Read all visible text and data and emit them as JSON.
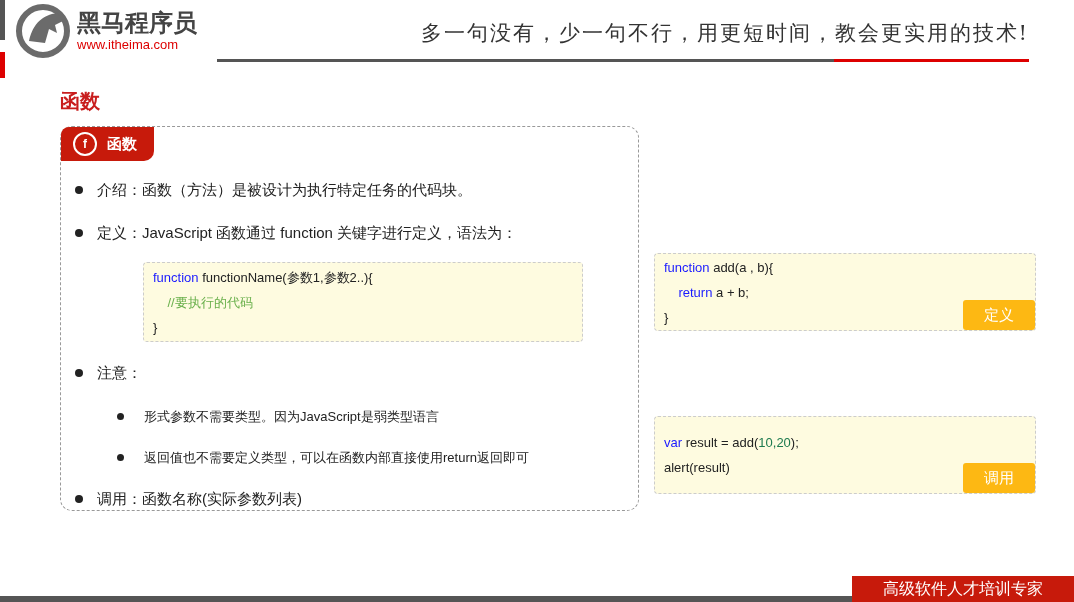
{
  "header": {
    "brand": "黑马程序员",
    "url": "www.itheima.com",
    "slogan": "多一句没有，少一句不行，用更短时间，教会更实用的技术!"
  },
  "section_title": "函数",
  "card": {
    "tab": {
      "icon_letter": "f",
      "label": "函数"
    },
    "items": [
      {
        "text": "介绍：函数（方法）是被设计为执行特定任务的代码块。"
      },
      {
        "text": "定义：JavaScript 函数通过 function 关键字进行定义，语法为：",
        "code": [
          {
            "tokens": [
              {
                "kind": "keyword",
                "text": "function"
              },
              {
                "kind": "plain",
                "text": " functionName(参数1,参数2..){"
              }
            ]
          },
          {
            "tokens": [
              {
                "kind": "comment",
                "text": "    //要执行的代码"
              }
            ]
          },
          {
            "tokens": [
              {
                "kind": "plain",
                "text": "}"
              }
            ]
          }
        ]
      },
      {
        "text": "注意：",
        "children": [
          {
            "text": "形式参数不需要类型。因为JavaScript是弱类型语言"
          },
          {
            "text": "返回值也不需要定义类型，可以在函数内部直接使用return返回即可"
          }
        ]
      },
      {
        "text": "调用：函数名称(实际参数列表)"
      }
    ]
  },
  "examples": [
    {
      "tag": "定义",
      "lines": [
        {
          "tokens": [
            {
              "kind": "keyword",
              "text": "function"
            },
            {
              "kind": "plain",
              "text": " add(a , b){"
            }
          ]
        },
        {
          "tokens": [
            {
              "kind": "keyword",
              "text": "    return"
            },
            {
              "kind": "plain",
              "text": " a + b;"
            }
          ]
        },
        {
          "tokens": [
            {
              "kind": "plain",
              "text": "}"
            }
          ]
        }
      ]
    },
    {
      "tag": "调用",
      "lines": [
        {
          "tokens": [
            {
              "kind": "keyword",
              "text": "var"
            },
            {
              "kind": "plain",
              "text": " result = add("
            },
            {
              "kind": "number",
              "text": "10,20"
            },
            {
              "kind": "plain",
              "text": ");"
            }
          ]
        },
        {
          "tokens": [
            {
              "kind": "plain",
              "text": "alert(result)"
            }
          ]
        }
      ]
    }
  ],
  "footer": {
    "tagline": "高级软件人才培训专家"
  }
}
